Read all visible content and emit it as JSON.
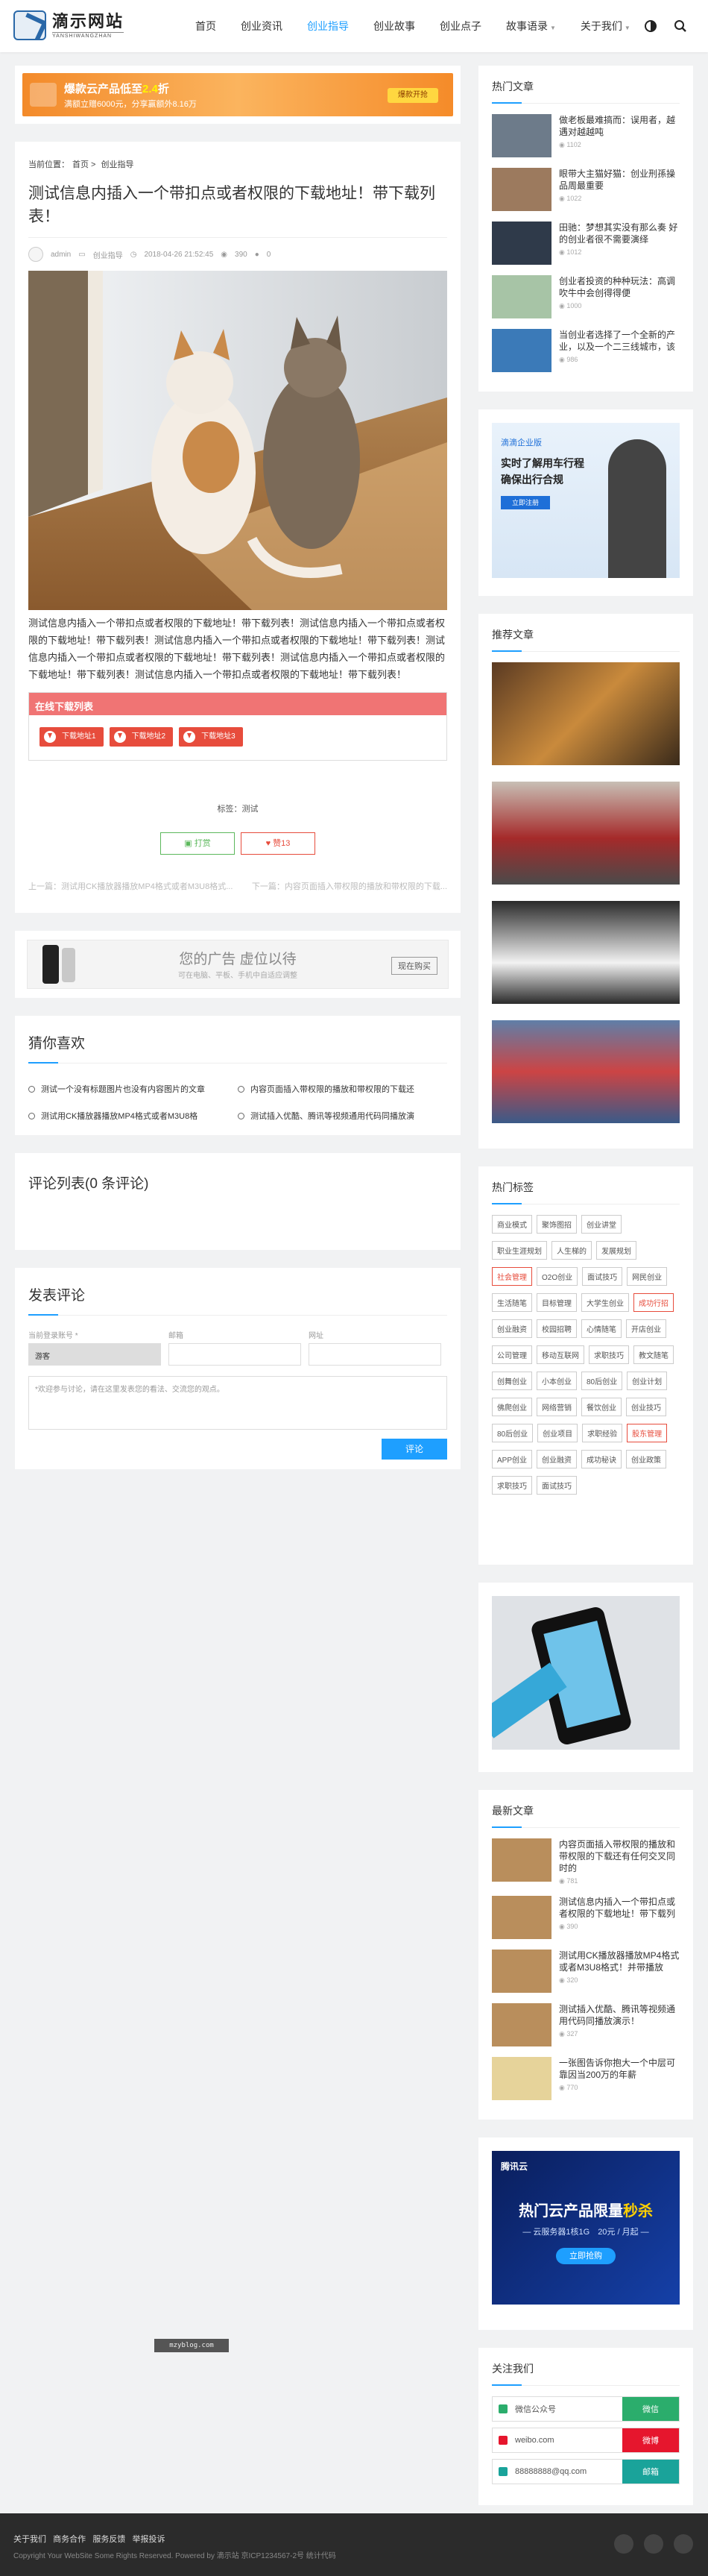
{
  "site": {
    "title": "滴示网站",
    "subtitle": "YANSHIWANGZHAN"
  },
  "nav": [
    {
      "label": "首页"
    },
    {
      "label": "创业资讯"
    },
    {
      "label": "创业指导"
    },
    {
      "label": "创业故事"
    },
    {
      "label": "创业点子"
    },
    {
      "label": "故事语录"
    },
    {
      "label": "关于我们"
    }
  ],
  "banner": {
    "title_prefix": "爆款云产品低至",
    "title_highlight": "2.4",
    "title_suffix": "折",
    "sub": "满额立赠6000元，分享赢额外8.16万",
    "button": "爆款开抢"
  },
  "article": {
    "breadcrumb_label": "当前位置：",
    "breadcrumb": [
      "首页",
      "创业指导"
    ],
    "title": "测试信息内插入一个带扣点或者权限的下载地址！带下载列表！",
    "author": "admin",
    "category": "创业指导",
    "date": "2018-04-26 21:52:45",
    "views": "390",
    "comments": "0",
    "body": "测试信息内插入一个带扣点或者权限的下载地址！带下载列表！测试信息内插入一个带扣点或者权限的下载地址！带下载列表！测试信息内插入一个带扣点或者权限的下载地址！带下载列表！测试信息内插入一个带扣点或者权限的下载地址！带下载列表！测试信息内插入一个带扣点或者权限的下载地址！带下载列表！测试信息内插入一个带扣点或者权限的下载地址！带下载列表！",
    "download_title": "在线下载列表",
    "downloads": [
      "下载地址1",
      "下载地址2",
      "下载地址3"
    ],
    "tags_label": "标签：",
    "tag": "测试",
    "btn_reward": "打赏",
    "btn_like": "赞13",
    "prev": "上一篇：测试用CK播放器播放MP4格式或者M3U8格式...",
    "next": "下一篇：内容页面插入带权限的播放和带权限的下载..."
  },
  "ad": {
    "title": "您的广告 虚位以待",
    "sub": "可在电脑、平板、手机中自适应调整",
    "button": "现在购买"
  },
  "guess": {
    "title": "猜你喜欢",
    "items": [
      "测试一个没有标题图片也没有内容图片的文章",
      "内容页面插入带权限的播放和带权限的下载还",
      "测试用CK播放器播放MP4格式或者M3U8格",
      "测试插入优酷、腾讯等视频通用代码同播放演"
    ]
  },
  "comments": {
    "title": "评论列表(0 条评论)"
  },
  "form": {
    "title": "发表评论",
    "label_nick": "当前登录账号 *",
    "label_email": "邮箱",
    "label_site": "网址",
    "nick_value": "游客",
    "textarea_placeholder": "*欢迎参与讨论，请在这里发表您的看法、交流您的观点。",
    "submit": "评论"
  },
  "hot": {
    "title": "热门文章",
    "items": [
      {
        "title": "做老板最难搞而：误用者，越遇对越越吨",
        "views": "1102"
      },
      {
        "title": "眼带大主猫好猫：创业刑孫操品周最重要",
        "views": "1022"
      },
      {
        "title": "田驰：梦想其实没有那么奏 好的创业者很不需要演绎",
        "views": "1012"
      },
      {
        "title": "创业者投资的种种玩法：高调吹牛中会创得得便",
        "views": "1000"
      },
      {
        "title": "当创业者选择了一个全新的产业，以及一个二三线城市，该",
        "views": "986"
      }
    ]
  },
  "side_ad": {
    "brand": "滴滴企业版",
    "line1": "实时了解用车行程",
    "line2": "确保出行合规",
    "button": "立即注册"
  },
  "recommend": {
    "title": "推荐文章"
  },
  "tags": {
    "title": "热门标签",
    "list": [
      "商业模式",
      "聚饰图招",
      "创业讲堂",
      "职业生涯规划",
      "人生梯的",
      "发展规划",
      "社会管理",
      "O2O创业",
      "面试技巧",
      "网民创业",
      "生活随笔",
      "目标管理",
      "大学生创业",
      "成功行招",
      "创业融资",
      "校园招聘",
      "心情随笔",
      "开店创业",
      "公司管理",
      "移动互联网",
      "求职技巧",
      "教文随笔",
      "创舞创业",
      "小本创业",
      "80后创业",
      "创业计划",
      "佛爬创业",
      "网络营销",
      "餐饮创业",
      "创业技巧",
      "80后创业",
      "创业项目",
      "求职经验",
      "股东管理",
      "APP创业",
      "创业融资",
      "成功秘诀",
      "创业政策",
      "求职技巧",
      "面试技巧"
    ],
    "highlight": [
      "社会管理",
      "成功行招",
      "股东管理"
    ]
  },
  "latest": {
    "title": "最新文章",
    "items": [
      {
        "title": "内容页面插入带权限的播放和带权限的下载还有任何交叉同时的",
        "views": "781"
      },
      {
        "title": "测试信息内插入一个带扣点或者权限的下载地址！带下载列",
        "views": "390"
      },
      {
        "title": "测试用CK播放器播放MP4格式或者M3U8格式！并带播放",
        "views": "320"
      },
      {
        "title": "测试插入优酷、腾讯等视频通用代码同播放演示！",
        "views": "327"
      },
      {
        "title": "一张图告诉你抱大一个中层可靠因当200万的年薪",
        "views": "770"
      }
    ]
  },
  "cloud_ad": {
    "brand": "腾讯云",
    "line1": "热门云产品限量",
    "highlight": "秒杀",
    "line2": "— 云服务器1核1G　20元 / 月起 —",
    "button": "立即抢购"
  },
  "follow": {
    "title": "关注我们",
    "items": [
      {
        "label": "微信公众号",
        "btn": "微信"
      },
      {
        "label": "weibo.com",
        "btn": "微博"
      },
      {
        "label": "88888888@qq.com",
        "btn": "邮箱"
      }
    ]
  },
  "watermark": "mzyblog.com",
  "footer": {
    "links": [
      "关于我们",
      "商务合作",
      "服务反馈",
      "举报投诉"
    ],
    "copy": "Copyright Your WebSite Some Rights Reserved. Powered by 滴示站 京ICP1234567-2号 统计代码"
  },
  "colors": {
    "accent": "#1e9fff",
    "red": "#e74c3c",
    "green": "#5cb85c",
    "footer": "#2b2b2b"
  }
}
